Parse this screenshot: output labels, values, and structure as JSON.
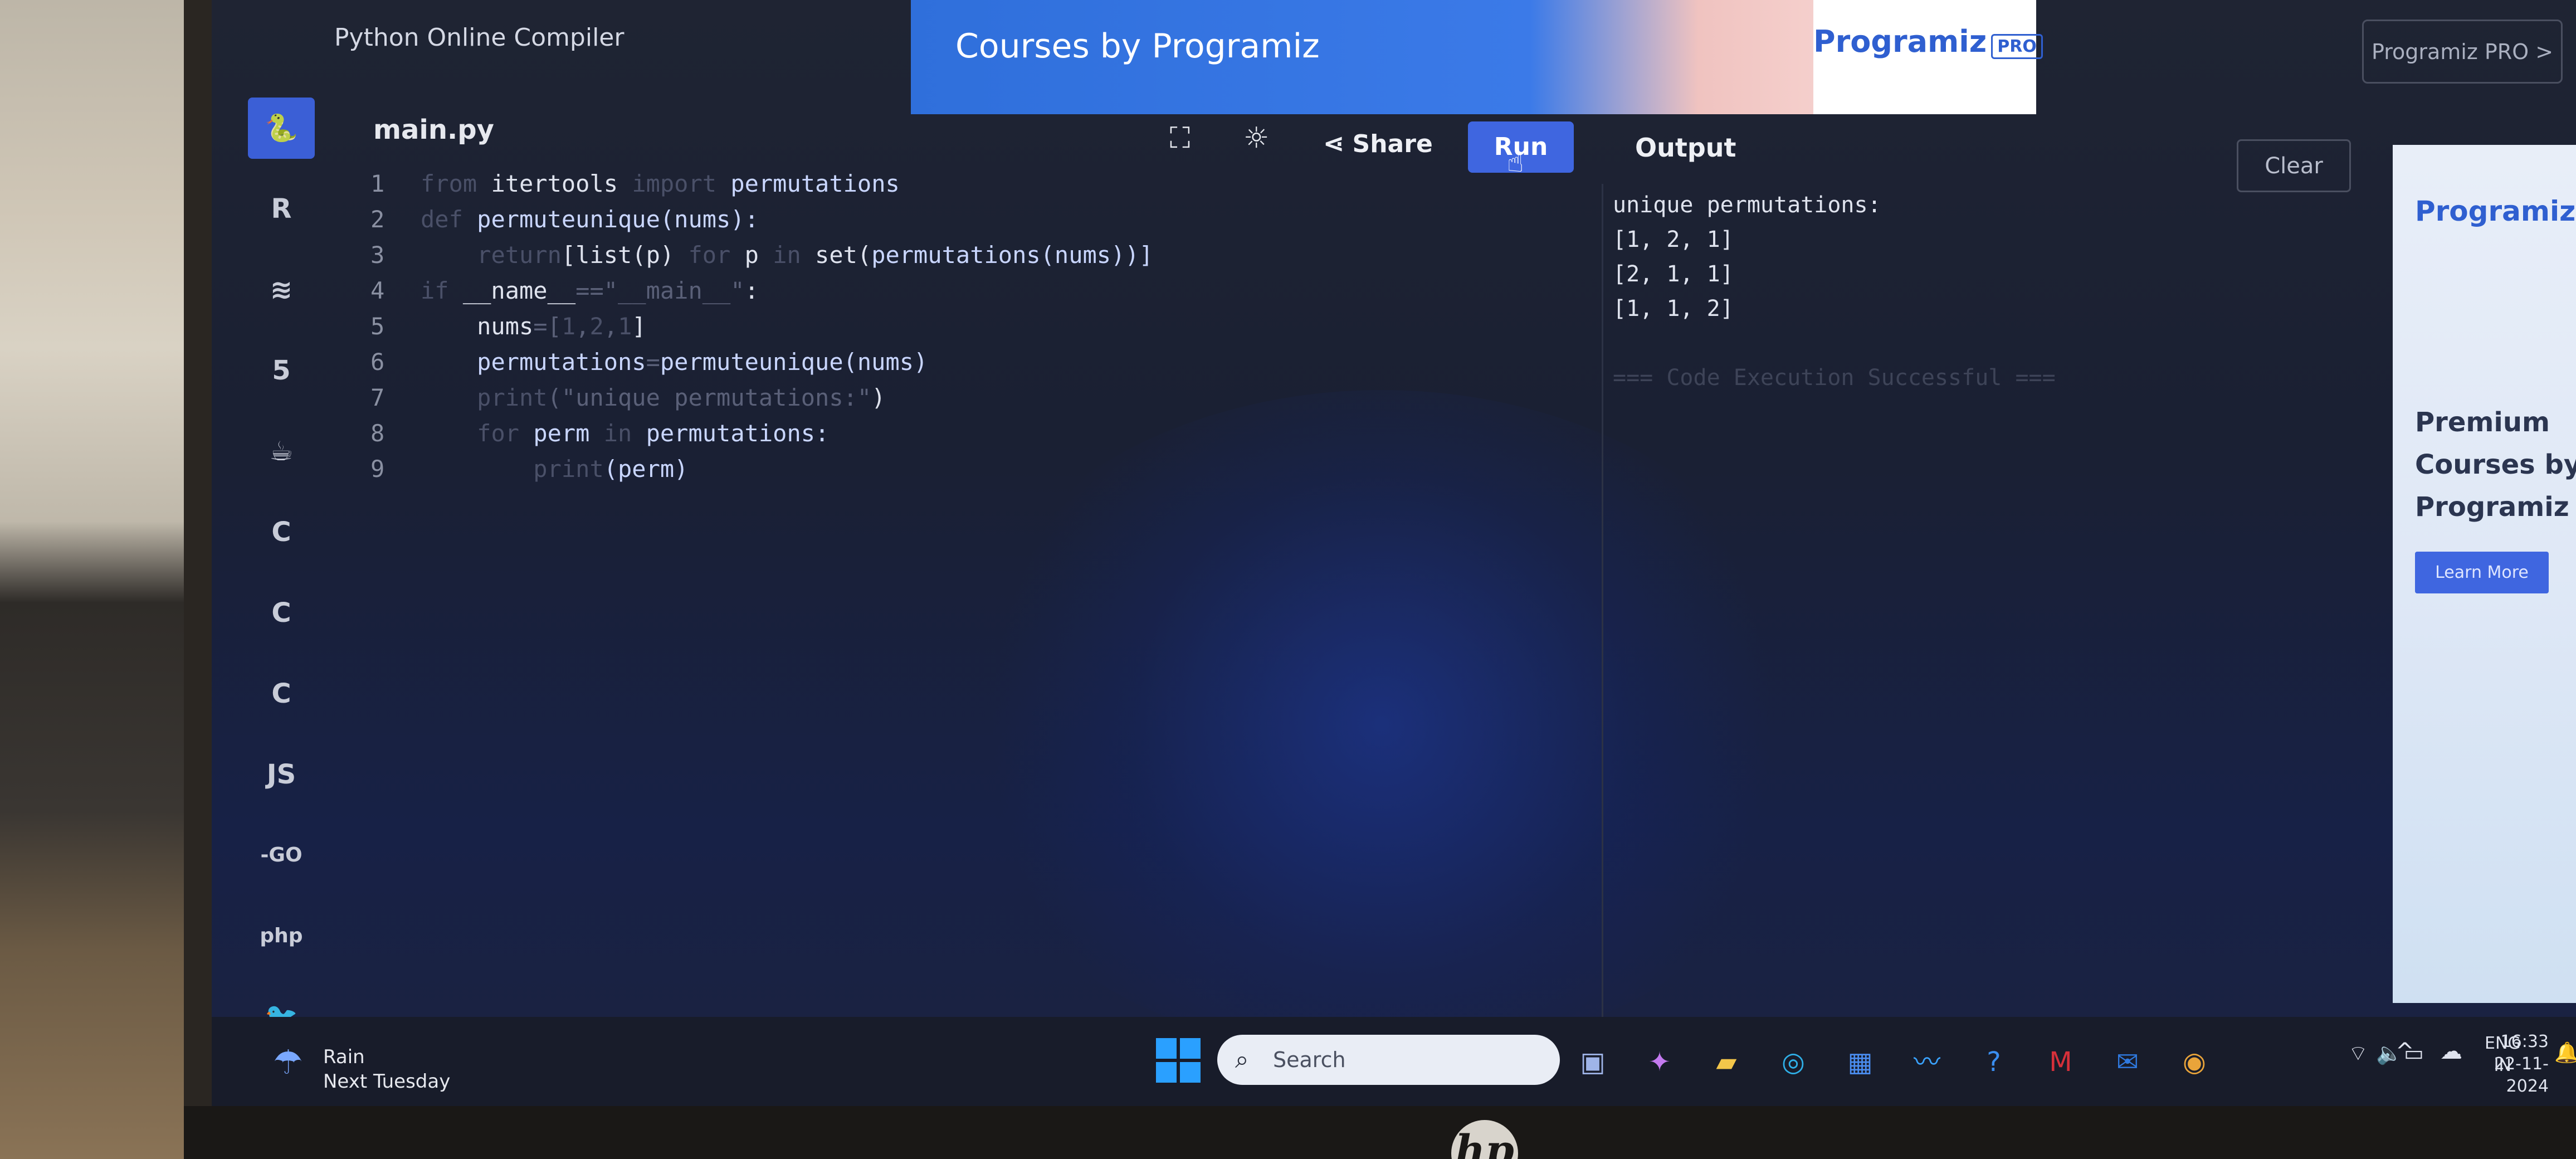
{
  "header": {
    "subtitle": "Python Online Compiler",
    "banner_title": "Courses by Programiz",
    "banner_brand": "Programiz",
    "banner_badge": "PRO",
    "pro_button": "Programiz PRO >"
  },
  "sidebar": {
    "languages": [
      {
        "name": "python",
        "glyph": "🐍"
      },
      {
        "name": "r",
        "glyph": "R"
      },
      {
        "name": "sql",
        "glyph": "≋"
      },
      {
        "name": "html",
        "glyph": "5"
      },
      {
        "name": "java",
        "glyph": "☕"
      },
      {
        "name": "c",
        "glyph": "C"
      },
      {
        "name": "cpp",
        "glyph": "C"
      },
      {
        "name": "csharp",
        "glyph": "C"
      },
      {
        "name": "js",
        "glyph": "JS"
      },
      {
        "name": "go",
        "glyph": "-GO"
      },
      {
        "name": "php",
        "glyph": "php"
      },
      {
        "name": "swift",
        "glyph": "🐦"
      }
    ]
  },
  "editor": {
    "filename": "main.py",
    "lines": [
      {
        "n": "1",
        "parts": [
          [
            "kw",
            "from "
          ],
          [
            "plain",
            "itertools "
          ],
          [
            "kw",
            "import "
          ],
          [
            "fn",
            "permutations"
          ]
        ]
      },
      {
        "n": "2",
        "parts": [
          [
            "kw",
            "def "
          ],
          [
            "fn",
            "permuteunique(nums):"
          ]
        ]
      },
      {
        "n": "3",
        "parts": [
          [
            "plain",
            "    "
          ],
          [
            "kw",
            "return"
          ],
          [
            "plain",
            "[list(p) "
          ],
          [
            "kw",
            "for "
          ],
          [
            "plain",
            "p "
          ],
          [
            "kw",
            "in "
          ],
          [
            "plain",
            "set("
          ],
          [
            "fn",
            "permutations(nums))]"
          ]
        ]
      },
      {
        "n": "4",
        "parts": [
          [
            "kw",
            "if "
          ],
          [
            "plain",
            "__name__"
          ],
          [
            "str",
            "==\"__main__\""
          ],
          [
            "plain",
            ":"
          ]
        ]
      },
      {
        "n": "5",
        "parts": [
          [
            "plain",
            "    nums"
          ],
          [
            "str",
            "=["
          ],
          [
            "kw",
            "1"
          ],
          [
            "str",
            ","
          ],
          [
            "kw",
            "2"
          ],
          [
            "str",
            ","
          ],
          [
            "kw",
            "1"
          ],
          [
            "plain",
            "]"
          ]
        ]
      },
      {
        "n": "6",
        "parts": [
          [
            "plain",
            "    "
          ],
          [
            "fn",
            "permutations"
          ],
          [
            "str",
            "="
          ],
          [
            "fn",
            "permuteunique(nums)"
          ]
        ]
      },
      {
        "n": "7",
        "parts": [
          [
            "plain",
            "    "
          ],
          [
            "kw",
            "print"
          ],
          [
            "str",
            "(\"unique permutations:\""
          ],
          [
            "plain",
            ")"
          ]
        ]
      },
      {
        "n": "8",
        "parts": [
          [
            "plain",
            "    "
          ],
          [
            "kw",
            "for "
          ],
          [
            "fn",
            "perm "
          ],
          [
            "kw",
            "in "
          ],
          [
            "fn",
            "permutations:"
          ]
        ]
      },
      {
        "n": "9",
        "parts": [
          [
            "plain",
            "        "
          ],
          [
            "kw",
            "print"
          ],
          [
            "fn",
            "(perm)"
          ]
        ]
      }
    ]
  },
  "toolbar": {
    "share_label": "Share",
    "run_label": "Run"
  },
  "output": {
    "label": "Output",
    "clear_label": "Clear",
    "lines": [
      "unique permutations:",
      "[1, 2, 1]",
      "[2, 1, 1]",
      "[1, 1, 2]"
    ],
    "footer": "=== Code Execution Successful ==="
  },
  "ad": {
    "brand": "Programiz",
    "text": "Premium Courses by Programiz",
    "button": "Learn More"
  },
  "taskbar": {
    "weather_title": "Rain",
    "weather_sub": "Next Tuesday",
    "search_placeholder": "Search",
    "lang_top": "ENG",
    "lang_bottom": "IN",
    "time": "16:33",
    "date": "22-11-2024"
  },
  "colors": {
    "accent": "#3f66e0",
    "background": "#1a2033"
  }
}
